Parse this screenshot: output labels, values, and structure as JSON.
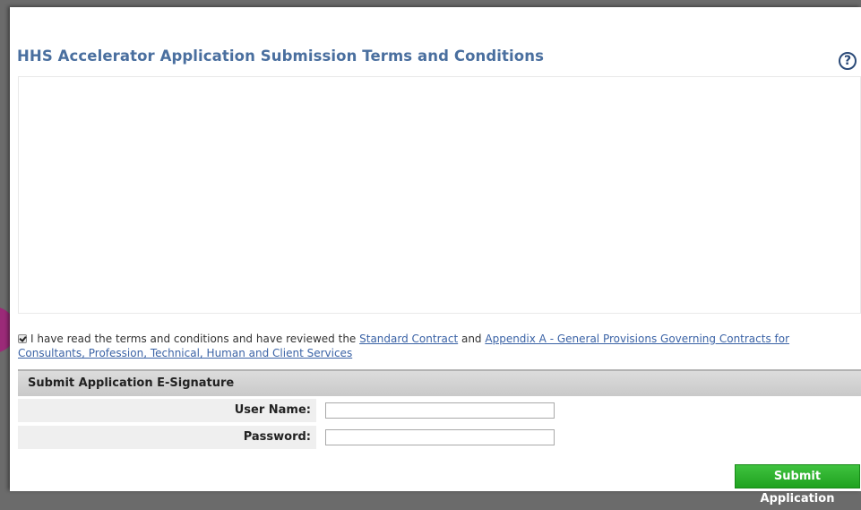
{
  "page": {
    "title": "HHS Accelerator Application Submission Terms and Conditions",
    "help_icon": "?"
  },
  "agreement": {
    "checked": true,
    "text_before": "I have read the terms and conditions and have reviewed the ",
    "link_standard_contract": "Standard Contract",
    "text_and": " and ",
    "link_appendix": "Appendix A - General Provisions Governing Contracts for Consultants, Profession, Technical, Human and Client Services"
  },
  "signature": {
    "header": "Submit Application E-Signature",
    "username_label": "User Name:",
    "username_value": "",
    "password_label": "Password:",
    "password_value": ""
  },
  "actions": {
    "submit_label": "Submit Application"
  },
  "colors": {
    "title": "#4a6f9f",
    "link": "#3b63a6",
    "submit": "#2fb02f",
    "marker": "#9b2a78"
  }
}
